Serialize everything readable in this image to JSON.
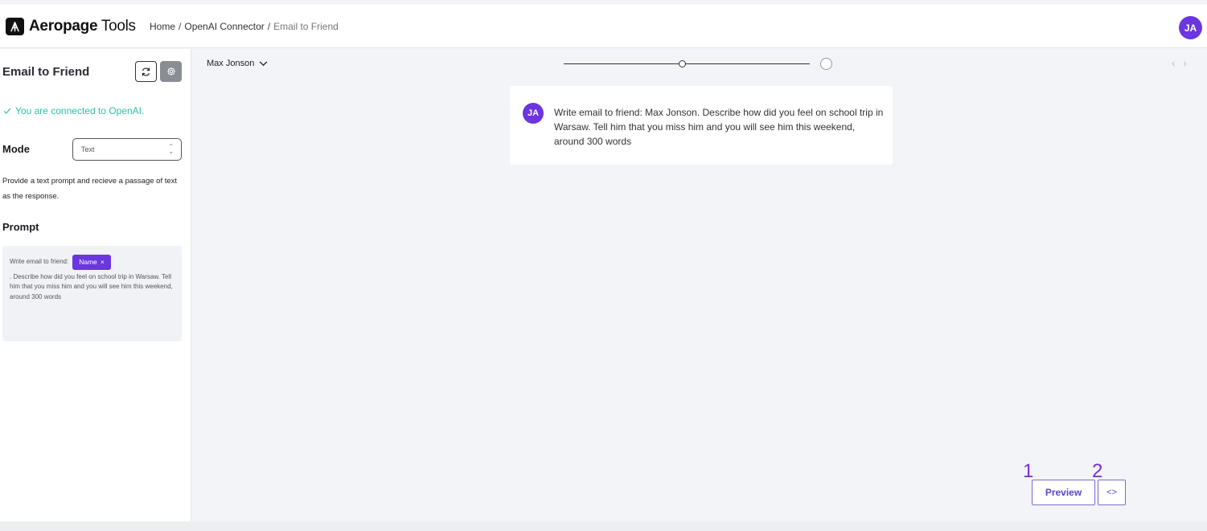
{
  "brand": {
    "name_bold": "Aeropage",
    "name_regular": "Tools"
  },
  "breadcrumb": {
    "home": "Home",
    "section": "OpenAI Connector",
    "current": "Email to Friend",
    "separator": "/"
  },
  "user": {
    "initials": "JA"
  },
  "sidebar": {
    "title": "Email to Friend",
    "connection_status": "You are connected to OpenAI.",
    "mode_label": "Mode",
    "mode_value": "Text",
    "mode_description": "Provide a text prompt and recieve a passage of text as the response.",
    "prompt_label": "Prompt",
    "prompt": {
      "prefix": "Write email to friend:",
      "tag_label": "Name",
      "tag_remove": "×",
      "suffix": ". Describe how did you feel on school trip in Warsaw. Tell him that you miss him and you will see him this weekend, around 300 words"
    }
  },
  "main": {
    "recipient": "Max Jonson",
    "slider_progress": 0.48,
    "message": {
      "avatar_initials": "JA",
      "text": "Write email to friend: Max Jonson. Describe how did you feel on school trip in Warsaw. Tell him that you miss him and you will see him this weekend, around 300 words"
    },
    "annotations": [
      "1",
      "2"
    ],
    "preview_label": "Preview",
    "code_label": "<>"
  },
  "colors": {
    "accent": "#6b35e0",
    "success": "#2fc0a8",
    "button_border": "#7b6bd6"
  }
}
